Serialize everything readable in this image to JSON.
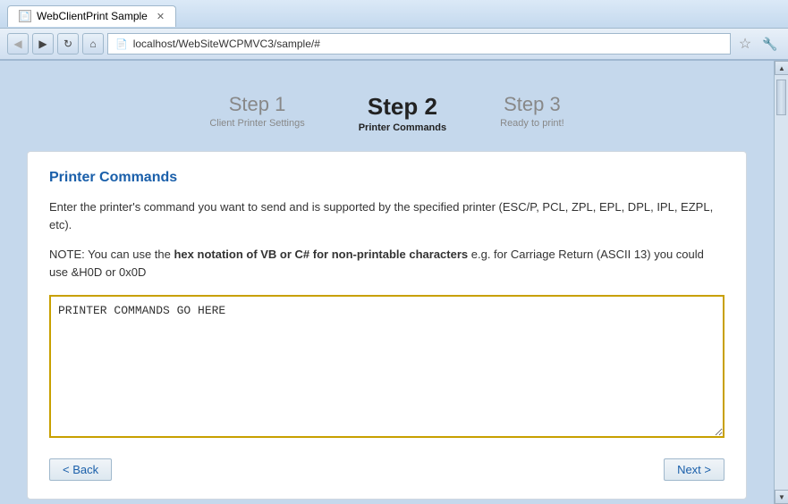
{
  "browser": {
    "title": "WebClientPrint Sample",
    "url": "localhost/WebSiteWCPMVC3/sample/#",
    "back_btn": "◀",
    "forward_btn": "▶",
    "refresh_btn": "↻",
    "home_btn": "⌂",
    "star_btn": "☆",
    "wrench_btn": "🔧"
  },
  "wizard": {
    "steps": [
      {
        "id": "step1",
        "number": "Step 1",
        "label": "Client Printer Settings",
        "active": false
      },
      {
        "id": "step2",
        "number": "Step 2",
        "label": "Printer Commands",
        "active": true
      },
      {
        "id": "step3",
        "number": "Step 3",
        "label": "Ready to print!",
        "active": false
      }
    ]
  },
  "card": {
    "title": "Printer Commands",
    "description": "Enter the printer's command you want to send and is supported by the specified printer (ESC/P, PCL, ZPL, EPL, DPL, IPL, EZPL, etc).",
    "note_prefix": "NOTE: You can use the ",
    "note_bold": "hex notation of VB or C# for non-printable characters",
    "note_suffix": " e.g. for Carriage Return (ASCII 13) you could use &H0D or 0x0D",
    "textarea_placeholder": "PRINTER COMMANDS GO HERE",
    "textarea_value": "PRINTER COMMANDS GO HERE"
  },
  "navigation": {
    "back_label": "< Back",
    "next_label": "Next >"
  }
}
